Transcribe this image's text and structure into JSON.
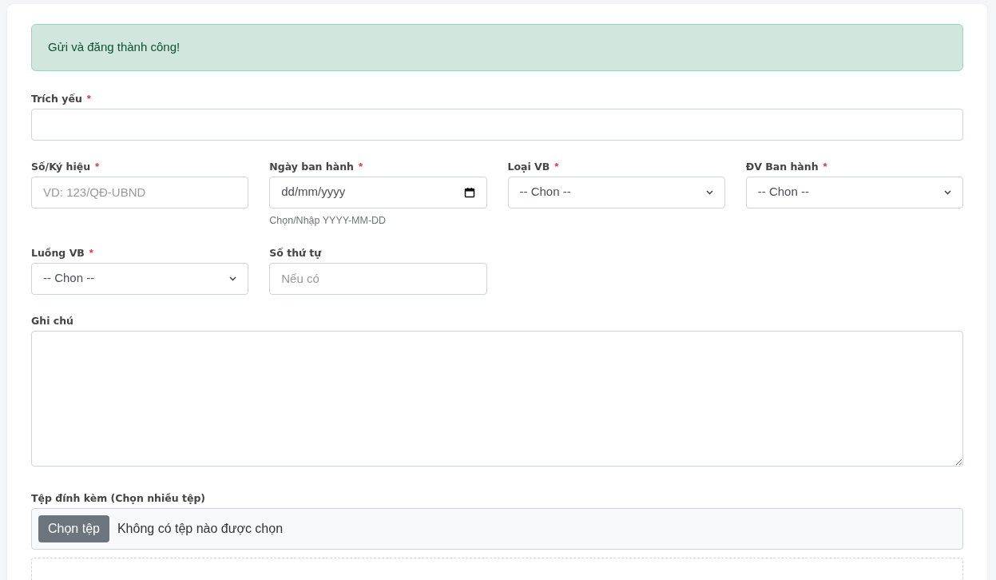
{
  "alert": {
    "text": "Gửi và đăng thành công!"
  },
  "rows": [
    [
      {
        "kind": "text",
        "label": "Trích yếu",
        "required_mark": "*"
      }
    ],
    [
      {
        "kind": "text",
        "label": "Số/Ký hiệu",
        "required_mark": "*",
        "placeholder": "VD: 123/QĐ-UBND"
      },
      {
        "kind": "date",
        "label": "Ngày ban hành",
        "required_mark": "*",
        "value": "dd/mm/yyyy",
        "hint": "Chọn/Nhập YYYY-MM-DD"
      },
      {
        "kind": "select",
        "label": "Loại VB",
        "required_mark": "*",
        "value": "-- Chon --"
      },
      {
        "kind": "select",
        "label": "ĐV Ban hành",
        "required_mark": "*",
        "value": "-- Chon --"
      }
    ],
    [
      {
        "kind": "select",
        "label": "Luồng VB",
        "required_mark": "*",
        "value": "-- Chon --"
      },
      {
        "kind": "text",
        "label": "Số thứ tự",
        "placeholder": "Nếu có"
      }
    ],
    [
      {
        "kind": "textarea",
        "label": "Ghi chú"
      }
    ],
    [
      {
        "kind": "file",
        "label": "Tệp đính kèm (Chọn nhiều tệp)",
        "button": "Chọn tệp",
        "value": "Không có tệp nào được chọn"
      }
    ]
  ]
}
